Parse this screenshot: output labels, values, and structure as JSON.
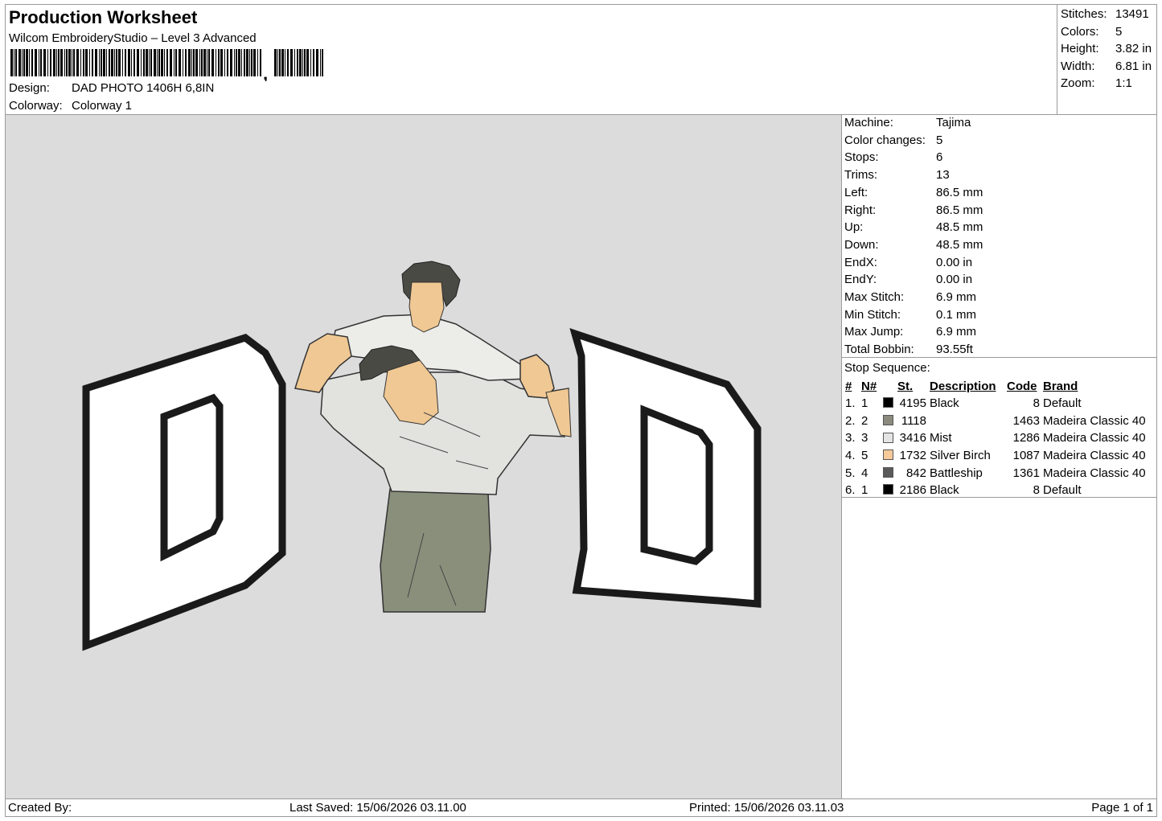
{
  "header": {
    "title": "Production Worksheet",
    "software": "Wilcom EmbroideryStudio – Level 3 Advanced",
    "design_label": "Design:",
    "design_value": "DAD PHOTO 1406H 6,8IN",
    "colorway_label": "Colorway:",
    "colorway_value": "Colorway 1"
  },
  "summary": [
    {
      "label": "Stitches:",
      "value": "13491"
    },
    {
      "label": "Colors:",
      "value": "5"
    },
    {
      "label": "Height:",
      "value": "3.82 in"
    },
    {
      "label": "Width:",
      "value": "6.81 in"
    },
    {
      "label": "Zoom:",
      "value": "1:1"
    }
  ],
  "machine": [
    {
      "label": "Machine:",
      "value": "Tajima"
    },
    {
      "label": "Color changes:",
      "value": "5"
    },
    {
      "label": "Stops:",
      "value": "6"
    },
    {
      "label": "Trims:",
      "value": "13"
    },
    {
      "label": "Left:",
      "value": "86.5 mm"
    },
    {
      "label": "Right:",
      "value": "86.5 mm"
    },
    {
      "label": "Up:",
      "value": "48.5 mm"
    },
    {
      "label": "Down:",
      "value": "48.5 mm"
    },
    {
      "label": "EndX:",
      "value": "0.00 in"
    },
    {
      "label": "EndY:",
      "value": "0.00 in"
    },
    {
      "label": "Max Stitch:",
      "value": "6.9 mm"
    },
    {
      "label": "Min Stitch:",
      "value": "0.1 mm"
    },
    {
      "label": "Max Jump:",
      "value": "6.9 mm"
    },
    {
      "label": "Total Bobbin:",
      "value": "93.55ft"
    }
  ],
  "stop_sequence": {
    "title": "Stop Sequence:",
    "headers": {
      "num": "#",
      "n": "N#",
      "st": "St.",
      "desc": "Description",
      "code": "Code",
      "brand": "Brand"
    },
    "rows": [
      {
        "num": "1.",
        "n": "1",
        "color": "#000000",
        "st": "4195",
        "desc": "Black",
        "code": "8",
        "brand": "Default"
      },
      {
        "num": "2.",
        "n": "2",
        "color": "#8a8a7e",
        "st": "1118",
        "desc": "",
        "code": "1463",
        "brand": "Madeira Classic 40"
      },
      {
        "num": "3.",
        "n": "3",
        "color": "#e4e4e4",
        "st": "3416",
        "desc": "Mist",
        "code": "1286",
        "brand": "Madeira Classic 40"
      },
      {
        "num": "4.",
        "n": "5",
        "color": "#f6c99a",
        "st": "1732",
        "desc": "Silver Birch",
        "code": "1087",
        "brand": "Madeira Classic 40"
      },
      {
        "num": "5.",
        "n": "4",
        "color": "#5a5a5a",
        "st": "842",
        "desc": "Battleship",
        "code": "1361",
        "brand": "Madeira Classic 40"
      },
      {
        "num": "6.",
        "n": "1",
        "color": "#000000",
        "st": "2186",
        "desc": "Black",
        "code": "8",
        "brand": "Default"
      }
    ]
  },
  "footer": {
    "created_by": "Created By:",
    "last_saved": "Last Saved: 15/06/2026 03.11.00",
    "printed": "Printed: 15/06/2026 03.11.03",
    "page": "Page 1 of 1"
  },
  "design_colors": {
    "outline": "#1a1a1a",
    "fill": "#ffffff",
    "shirt": "#e6e6e2",
    "child_shirt": "#ecece8",
    "skin": "#f0c894",
    "pants": "#8a8f7c",
    "hair": "#4a4a44"
  }
}
